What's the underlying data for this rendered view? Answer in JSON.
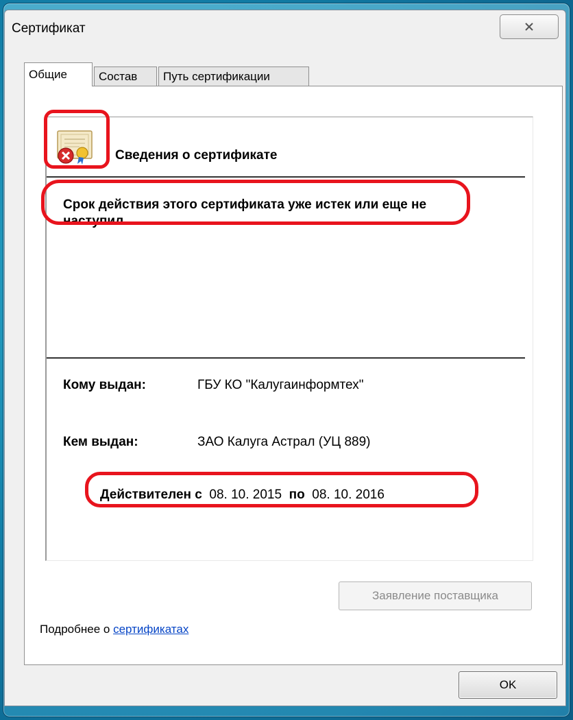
{
  "window": {
    "title": "Сертификат",
    "close_symbol": "✕"
  },
  "tabs": [
    {
      "label": "Общие",
      "active": true
    },
    {
      "label": "Состав",
      "active": false
    },
    {
      "label": "Путь сертификации",
      "active": false
    }
  ],
  "certificate": {
    "heading": "Сведения о сертификате",
    "icon": "certificate-error-icon",
    "warning": "Срок действия этого сертификата уже истек или еще не наступил.",
    "issued_to_label": "Кому выдан:",
    "issued_to_value": "ГБУ КО \"Калугаинформтех\"",
    "issued_by_label": "Кем выдан:",
    "issued_by_value": "ЗАО Калуга Астрал (УЦ 889)",
    "valid_from_label": "Действителен с",
    "valid_from_value": "08. 10. 2015",
    "valid_to_label": "по",
    "valid_to_value": "08. 10. 2016"
  },
  "buttons": {
    "issuer_statement": "Заявление поставщика",
    "ok": "OK"
  },
  "footer": {
    "learn_more_prefix": "Подробнее о ",
    "learn_more_link": "сертификатах"
  },
  "colors": {
    "highlight": "#e8141d",
    "link": "#0645c6"
  }
}
